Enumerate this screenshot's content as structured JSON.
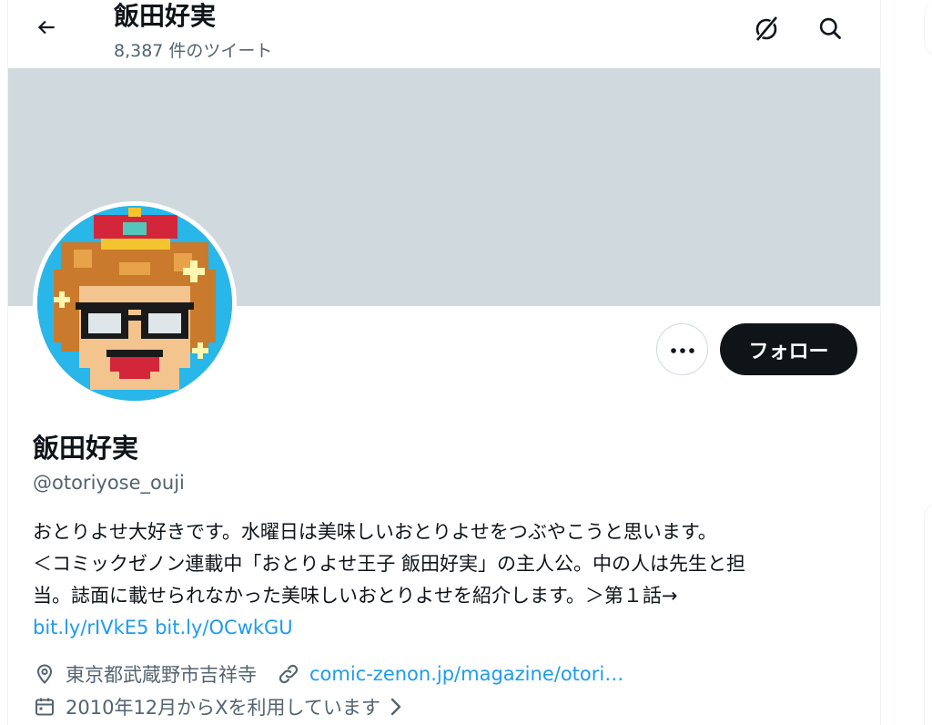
{
  "header": {
    "title": "飯田好実",
    "tweet_count": "8,387 件のツイート"
  },
  "profile": {
    "name": "飯田好実",
    "handle": "@otoriyose_ouji",
    "follow_label": "フォロー"
  },
  "bio": {
    "line1": "おとりよせ大好きです。水曜日は美味しいおとりよせをつぶやこうと思います。",
    "line2": "＜コミックゼノン連載中「おとりよせ王子 飯田好実」の主人公。中の人は先生と担",
    "line3": "当。誌面に載せられなかった美味しいおとりよせを紹介します。＞第１話→",
    "link1": "bit.ly/rIVkE5",
    "link2": "bit.ly/OCwkGU"
  },
  "meta": {
    "location": "東京都武蔵野市吉祥寺",
    "website": "comic-zenon.jp/magazine/otori…",
    "joined": "2010年12月からXを利用しています"
  },
  "icons": {
    "back": "arrow-left-icon",
    "grok": "grok-icon",
    "search": "search-icon",
    "more": "more-dots-icon",
    "location": "location-pin-icon",
    "link": "link-icon",
    "calendar": "calendar-icon",
    "chevron": "chevron-right-icon"
  },
  "colors": {
    "banner": "#cfd9de",
    "link": "#1d9bf0",
    "secondary_text": "#536471",
    "button_dark": "#0f1419"
  }
}
